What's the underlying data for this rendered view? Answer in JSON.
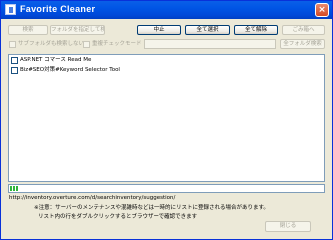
{
  "window": {
    "title": "Favorite  Cleaner",
    "close_glyph": "×"
  },
  "toolbar": {
    "search_label": "検索",
    "folder_search_label": "フォルダを指定して検索",
    "stop_label": "中止",
    "select_all_label": "全て選択",
    "deselect_all_label": "全て解除",
    "trash_label": "ごみ箱へ",
    "subfolder_label": "サブフォルダも検索しない",
    "duplicate_check_label": "重複チェックモード",
    "all_folders_label": "全フォルダ検索",
    "close_label": "閉じる"
  },
  "results": {
    "items": [
      {
        "label": "ASP.NET コマース Read Me",
        "checked": false
      },
      {
        "label": "Biz#SEO対策#Keyword Selector Tool",
        "checked": false
      }
    ]
  },
  "status": {
    "progress": 0.03,
    "url": "http://inventory.overture.com/d/searchinventory/suggestion/",
    "note_line1": "※注意：サーバーのメンテナンスや混雑時などは一時的にリストに登録される場合があります。",
    "note_line2": "リスト内の行をダブルクリックするとブラウザーで確認できます"
  }
}
